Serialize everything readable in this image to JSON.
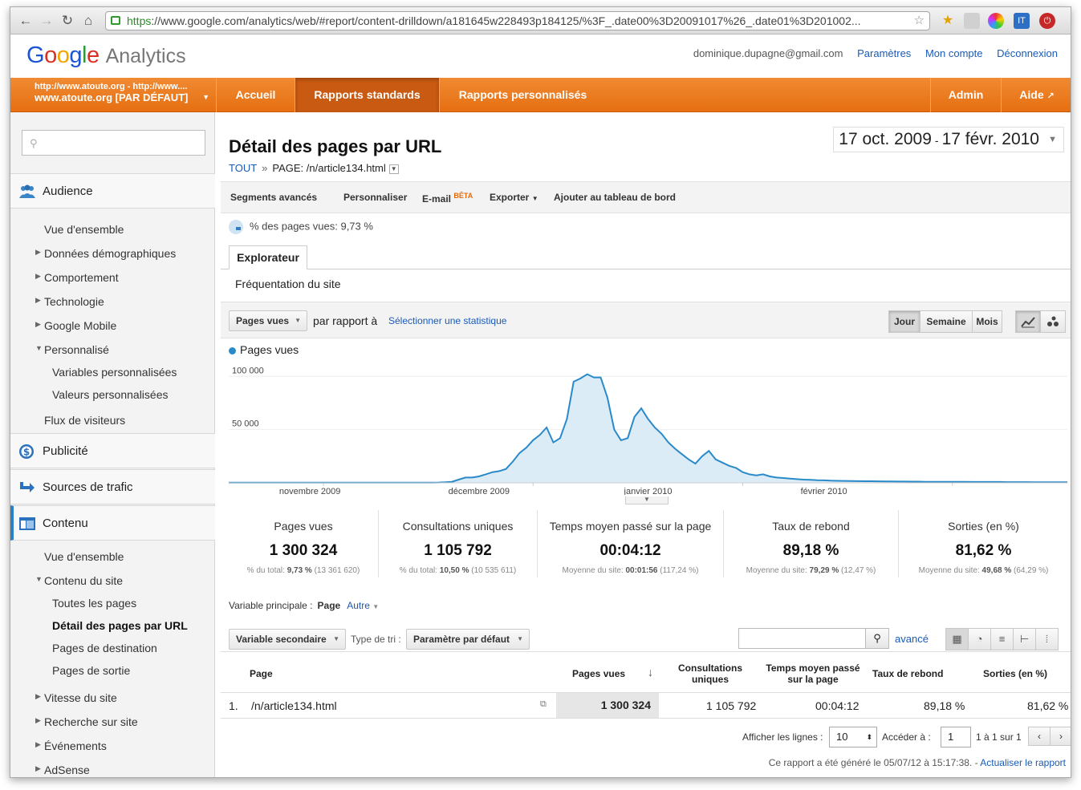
{
  "browser": {
    "url_scheme": "https",
    "url_rest": "://www.google.com/analytics/web/#report/content-drilldown/a181645w228493p184125/%3F_.date00%3D20091017%26_.date01%3D201002..."
  },
  "header": {
    "logo_google": "Google",
    "logo_analytics": "Analytics",
    "email": "dominique.dupagne@gmail.com",
    "links": [
      "Paramètres",
      "Mon compte",
      "Déconnexion"
    ]
  },
  "nav": {
    "account_line1": "http://www.atoute.org - http://www....",
    "account_line2": "www.atoute.org [PAR DÉFAUT]",
    "tabs": [
      "Accueil",
      "Rapports standards",
      "Rapports personnalisés"
    ],
    "admin": "Admin",
    "help": "Aide"
  },
  "sidebar": {
    "search_placeholder": "",
    "sections": [
      "Audience",
      "Publicité",
      "Sources de trafic",
      "Contenu"
    ],
    "audience_items": [
      "Vue d'ensemble",
      "Données démographiques",
      "Comportement",
      "Technologie",
      "Google Mobile",
      "Personnalisé",
      "Variables personnalisées",
      "Valeurs personnalisées",
      "Flux de visiteurs"
    ],
    "content_items": [
      "Vue d'ensemble",
      "Contenu du site",
      "Toutes les pages",
      "Détail des pages par URL",
      "Pages de destination",
      "Pages de sortie",
      "Vitesse du site",
      "Recherche sur site",
      "Événements",
      "AdSense"
    ]
  },
  "report": {
    "title": "Détail des pages par URL",
    "breadcrumb_all": "TOUT",
    "breadcrumb_sep": "»",
    "breadcrumb_page": "PAGE: /n/article134.html",
    "date_start": "17 oct. 2009",
    "date_sep": "-",
    "date_end": "17 févr. 2010",
    "toolbar": [
      "Segments avancés",
      "Personnaliser",
      "E-mail",
      "Exporter",
      "Ajouter au tableau de bord"
    ],
    "beta": "BÊTA",
    "pct_views": "% des pages vues: 9,73 %",
    "explorer_tab": "Explorateur",
    "subtab": "Fréquentation du site",
    "metric_select": "Pages vues",
    "compare_label": "par rapport à",
    "compare_link": "Sélectionner une statistique",
    "granularity": [
      "Jour",
      "Semaine",
      "Mois"
    ]
  },
  "chart_data": {
    "type": "area",
    "series": [
      {
        "name": "Pages vues",
        "values": [
          200,
          200,
          200,
          200,
          200,
          200,
          200,
          200,
          200,
          200,
          200,
          200,
          200,
          200,
          200,
          200,
          200,
          200,
          200,
          200,
          200,
          200,
          200,
          200,
          200,
          200,
          200,
          200,
          200,
          200,
          200,
          300,
          500,
          1000,
          3000,
          5000,
          5000,
          6000,
          8000,
          10000,
          11000,
          13000,
          20000,
          28000,
          33000,
          40000,
          45000,
          52000,
          38000,
          42000,
          60000,
          95000,
          98000,
          102000,
          99000,
          99000,
          80000,
          50000,
          40000,
          42000,
          62000,
          70000,
          60000,
          52000,
          46000,
          38000,
          32000,
          27000,
          22000,
          18000,
          25000,
          30000,
          22000,
          19000,
          16000,
          14000,
          10000,
          8000,
          7000,
          8000,
          6000,
          5000,
          4500,
          4000,
          3500,
          3000,
          2800,
          2500,
          2300,
          2000,
          1900,
          1800,
          1700,
          1600,
          1500,
          1500,
          1400,
          1300,
          1300,
          1200,
          1200,
          1100,
          1100,
          1000,
          1000,
          1000,
          900,
          900,
          900,
          900,
          800,
          800,
          800,
          800,
          800,
          700,
          700,
          700,
          700,
          600,
          600,
          600,
          600,
          600,
          600
        ]
      }
    ],
    "x_tick_labels": [
      "novembre 2009",
      "décembre 2009",
      "janvier 2010",
      "février 2010"
    ],
    "y_tick_labels": [
      "100 000",
      "50 000"
    ],
    "ylim": [
      0,
      110000
    ],
    "color": "#2a8ac9",
    "fill": "#dcecf7"
  },
  "summary": [
    {
      "label": "Pages vues",
      "value": "1 300 324",
      "detail_prefix": "% du total: ",
      "detail_bold": "9,73 %",
      "detail_suffix": " (13 361 620)"
    },
    {
      "label": "Consultations uniques",
      "value": "1 105 792",
      "detail_prefix": "% du total: ",
      "detail_bold": "10,50 %",
      "detail_suffix": " (10 535 611)"
    },
    {
      "label": "Temps moyen passé sur la page",
      "value": "00:04:12",
      "detail_prefix": "Moyenne du site: ",
      "detail_bold": "00:01:56",
      "detail_suffix": " (117,24 %)"
    },
    {
      "label": "Taux de rebond",
      "value": "89,18 %",
      "detail_prefix": "Moyenne du site: ",
      "detail_bold": "79,29 %",
      "detail_suffix": " (12,47 %)"
    },
    {
      "label": "Sorties (en %)",
      "value": "81,62 %",
      "detail_prefix": "Moyenne du site: ",
      "detail_bold": "49,68 %",
      "detail_suffix": " (64,29 %)"
    }
  ],
  "table": {
    "primary_label": "Variable principale :",
    "primary_value": "Page",
    "primary_other": "Autre",
    "secondary": "Variable secondaire",
    "sort_label": "Type de tri :",
    "sort_value": "Paramètre par défaut",
    "advanced": "avancé",
    "headers": [
      "Page",
      "Pages vues",
      "Consultations uniques",
      "Temps moyen passé sur la page",
      "Taux de rebond",
      "Sorties (en %)"
    ],
    "rows": [
      {
        "index": "1.",
        "page": "/n/article134.html",
        "pageviews": "1 300 324",
        "unique": "1 105 792",
        "time": "00:04:12",
        "bounce": "89,18 %",
        "exits": "81,62 %"
      }
    ],
    "show_rows_label": "Afficher les lignes :",
    "show_rows_value": "10",
    "goto_label": "Accéder à :",
    "goto_value": "1",
    "range": "1 à 1 sur 1",
    "generated": "Ce rapport a été généré le 05/07/12 à 15:17:38. -",
    "refresh": "Actualiser le rapport"
  }
}
